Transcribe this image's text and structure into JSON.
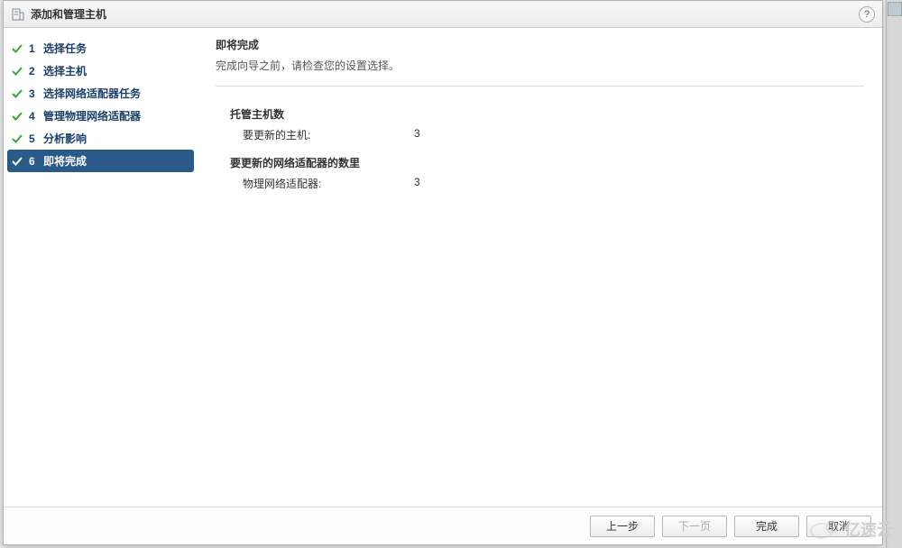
{
  "dialog": {
    "title": "添加和管理主机",
    "help_label": "?"
  },
  "steps": [
    {
      "num": "1",
      "label": "选择任务",
      "done": true,
      "active": false
    },
    {
      "num": "2",
      "label": "选择主机",
      "done": true,
      "active": false
    },
    {
      "num": "3",
      "label": "选择网络适配器任务",
      "done": true,
      "active": false
    },
    {
      "num": "4",
      "label": "管理物理网络适配器",
      "done": true,
      "active": false
    },
    {
      "num": "5",
      "label": "分析影响",
      "done": true,
      "active": false
    },
    {
      "num": "6",
      "label": "即将完成",
      "done": true,
      "active": true
    }
  ],
  "main": {
    "title": "即将完成",
    "subtitle": "完成向导之前，请检查您的设置选择。",
    "sections": [
      {
        "heading": "托管主机数",
        "rows": [
          {
            "label": "要更新的主机:",
            "value": "3"
          }
        ]
      },
      {
        "heading": "要更新的网络适配器的数里",
        "rows": [
          {
            "label": "物理网络适配器:",
            "value": "3"
          }
        ]
      }
    ]
  },
  "footer": {
    "back": "上一步",
    "next": "下一页",
    "finish": "完成",
    "cancel": "取消"
  },
  "watermark": "亿速云"
}
